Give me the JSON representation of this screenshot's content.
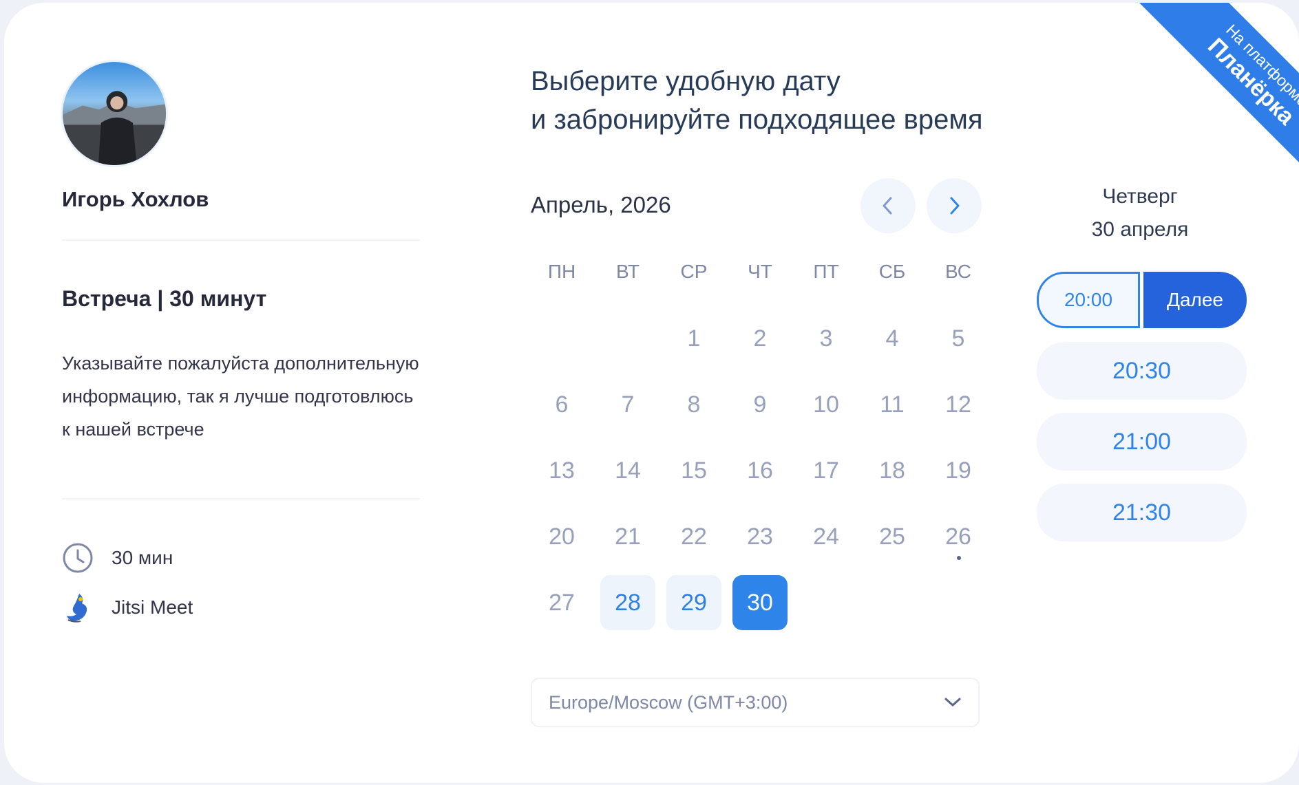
{
  "ribbon": {
    "line1": "На платформе",
    "line2": "Планёрка"
  },
  "host": {
    "name": "Игорь Хохлов"
  },
  "event": {
    "title": "Встреча | 30 минут",
    "description": "Указывайте пожалуйста дополнительную информацию, так я лучше подготовлюсь к нашей встрече",
    "duration": "30 мин",
    "location": "Jitsi Meet"
  },
  "heading": {
    "line1": "Выберите удобную дату",
    "line2": "и забронируйте подходящее время"
  },
  "calendar": {
    "month_label": "Апрель, 2026",
    "weekdays": [
      "ПН",
      "ВТ",
      "СР",
      "ЧТ",
      "ПТ",
      "СБ",
      "ВС"
    ],
    "leading_blanks": 2,
    "days": [
      {
        "n": "1"
      },
      {
        "n": "2"
      },
      {
        "n": "3"
      },
      {
        "n": "4"
      },
      {
        "n": "5"
      },
      {
        "n": "6"
      },
      {
        "n": "7"
      },
      {
        "n": "8"
      },
      {
        "n": "9"
      },
      {
        "n": "10"
      },
      {
        "n": "11"
      },
      {
        "n": "12"
      },
      {
        "n": "13"
      },
      {
        "n": "14"
      },
      {
        "n": "15"
      },
      {
        "n": "16"
      },
      {
        "n": "17"
      },
      {
        "n": "18"
      },
      {
        "n": "19"
      },
      {
        "n": "20"
      },
      {
        "n": "21"
      },
      {
        "n": "22"
      },
      {
        "n": "23"
      },
      {
        "n": "24"
      },
      {
        "n": "25"
      },
      {
        "n": "26",
        "today": true
      },
      {
        "n": "27"
      },
      {
        "n": "28",
        "available": true
      },
      {
        "n": "29",
        "available": true
      },
      {
        "n": "30",
        "available": true,
        "selected": true
      }
    ]
  },
  "timezone": {
    "value": "Europe/Moscow (GMT+3:00)"
  },
  "selected_day": {
    "weekday": "Четверг",
    "date": "30 апреля"
  },
  "slots": {
    "selected": "20:00",
    "next_label": "Далее",
    "others": [
      "20:30",
      "21:00",
      "21:30"
    ]
  },
  "colors": {
    "accent": "#2f84e9",
    "button": "#2563dc",
    "ribbon": "#2f7de8"
  }
}
